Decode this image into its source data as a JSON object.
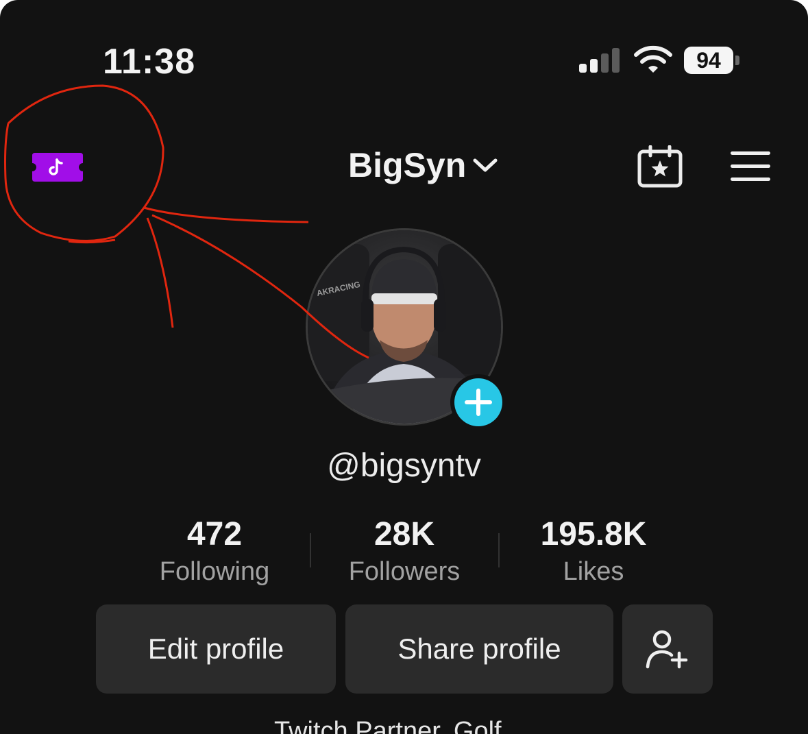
{
  "status_bar": {
    "time": "11:38",
    "battery": "94"
  },
  "header": {
    "title": "BigSyn"
  },
  "profile": {
    "handle": "@bigsyntv",
    "stats": [
      {
        "value": "472",
        "label": "Following"
      },
      {
        "value": "28K",
        "label": "Followers"
      },
      {
        "value": "195.8K",
        "label": "Likes"
      }
    ],
    "buttons": {
      "edit": "Edit profile",
      "share": "Share profile"
    },
    "bio": "Twitch Partner. Golf"
  },
  "icons": {
    "ticket": "tiktok-ticket-icon",
    "dropdown": "chevron-down-icon",
    "calendar": "calendar-star-icon",
    "menu": "hamburger-menu-icon",
    "add": "plus-icon",
    "add_friend": "add-user-icon"
  },
  "colors": {
    "accent_ticket": "#a10ee8",
    "accent_plus": "#28c7e6",
    "annotation": "#e0260f"
  }
}
